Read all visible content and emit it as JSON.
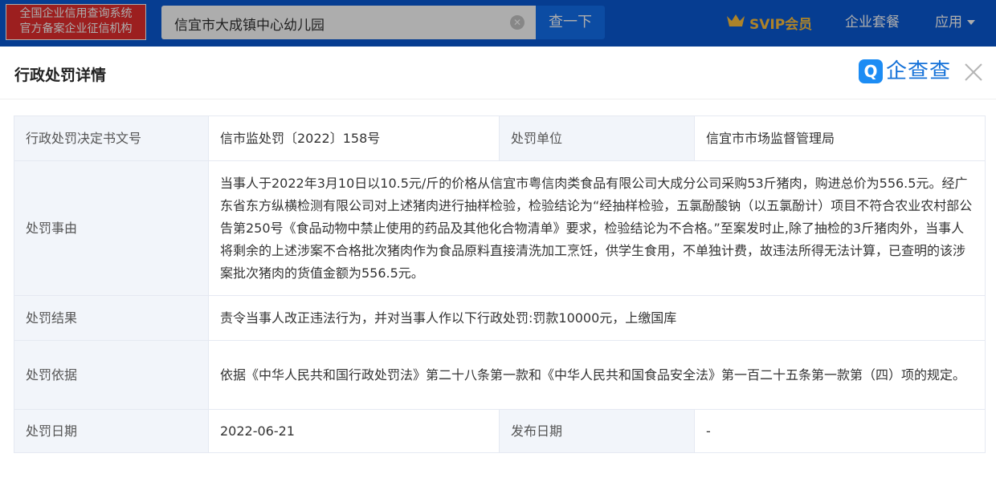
{
  "topbar": {
    "badge_line1": "全国企业信用查询系统",
    "badge_line2": "官方备案企业征信机构",
    "search_value": "信宜市大成镇中心幼儿园",
    "search_button": "查一下",
    "svip": "SVIP会员",
    "enterprise_package": "企业套餐",
    "apps": "应用"
  },
  "modal": {
    "title": "行政处罚详情",
    "brand": "企查查",
    "close": "×"
  },
  "detail": {
    "doc_number_label": "行政处罚决定书文号",
    "doc_number_value": "信市监处罚〔2022〕158号",
    "unit_label": "处罚单位",
    "unit_value": "信宜市市场监督管理局",
    "reason_label": "处罚事由",
    "reason_value": "当事人于2022年3月10日以10.5元/斤的价格从信宜市粤信肉类食品有限公司大成分公司采购53斤猪肉，购进总价为556.5元。经广东省东方纵横检测有限公司对上述猪肉进行抽样检验，检验结论为“经抽样检验，五氯酚酸钠（以五氯酚计）项目不符合农业农村部公告第250号《食品动物中禁止使用的药品及其他化合物清单》要求，检验结论为不合格。”至案发时止,除了抽检的3斤猪肉外，当事人将剩余的上述涉案不合格批次猪肉作为食品原料直接清洗加工烹饪，供学生食用，不单独计费，故违法所得无法计算，已查明的该涉案批次猪肉的货值金额为556.5元。",
    "result_label": "处罚结果",
    "result_value": "责令当事人改正违法行为，并对当事人作以下行政处罚:罚款10000元，上缴国库",
    "basis_label": "处罚依据",
    "basis_value": "依据《中华人民共和国行政处罚法》第二十八条第一款和《中华人民共和国食品安全法》第一百二十五条第一款第（四）项的规定。",
    "date_label": "处罚日期",
    "date_value": "2022-06-21",
    "publish_label": "发布日期",
    "publish_value": "-"
  },
  "colors": {
    "topbar_blue": "#0a5ad6",
    "badge_red": "#e62e2e",
    "svip_gold": "#ffc23d",
    "brand_blue": "#1471d8",
    "label_bg": "#f2f5fa"
  },
  "icons": [
    "clear-icon",
    "crown-icon",
    "chevron-down-icon",
    "qichacha-logo-icon",
    "close-icon"
  ]
}
